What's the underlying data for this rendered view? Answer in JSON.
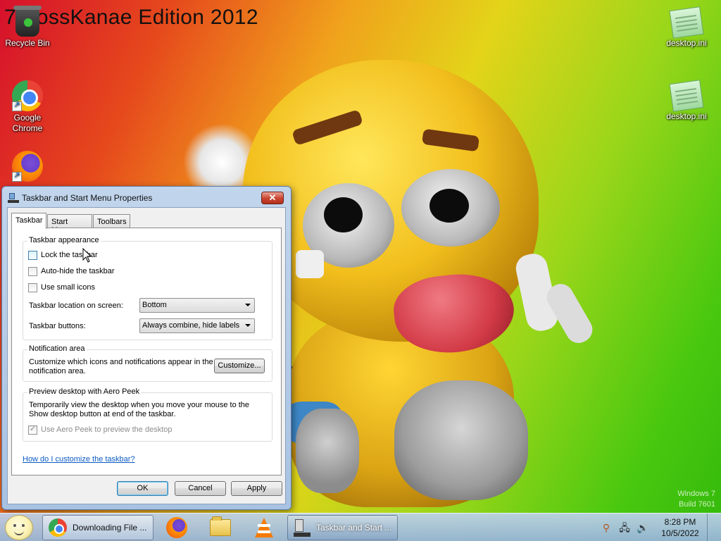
{
  "desktop": {
    "title": "7 BossKanae Edition 2012",
    "watermark_line1": "Windows 7",
    "watermark_line2": "Build 7601",
    "icons": [
      {
        "label": "Recycle Bin"
      },
      {
        "label": "Google Chrome"
      },
      {
        "label": "desktop.ini"
      },
      {
        "label": "desktop.ini"
      }
    ]
  },
  "dialog": {
    "title": "Taskbar and Start Menu Properties",
    "close_glyph": "✕",
    "tabs": [
      "Taskbar",
      "Start Menu",
      "Toolbars"
    ],
    "active_tab": "Taskbar",
    "appearance": {
      "heading": "Taskbar appearance",
      "lock_label": "Lock the taskbar",
      "lock_checked": false,
      "autohide_label": "Auto-hide the taskbar",
      "autohide_checked": false,
      "small_icons_label": "Use small icons",
      "small_icons_checked": false,
      "location_label": "Taskbar location on screen:",
      "location_value": "Bottom",
      "buttons_label": "Taskbar buttons:",
      "buttons_value": "Always combine, hide labels"
    },
    "notification": {
      "heading": "Notification area",
      "description": "Customize which icons and notifications appear in the notification area.",
      "customize_label": "Customize..."
    },
    "aero_peek": {
      "heading": "Preview desktop with Aero Peek",
      "description": "Temporarily view the desktop when you move your mouse to the Show desktop button at end of the taskbar.",
      "checkbox_label": "Use Aero Peek to preview the desktop",
      "checked": true,
      "enabled": false
    },
    "help_link": "How do I customize the taskbar?",
    "ok_label": "OK",
    "cancel_label": "Cancel",
    "apply_label": "Apply"
  },
  "taskbar": {
    "buttons": [
      {
        "label": "Downloading File ...",
        "icon": "chrome-icon"
      },
      {
        "label": "Taskbar and Start ...",
        "icon": "taskbar-properties-icon"
      }
    ],
    "pinned": [
      "firefox-icon",
      "folder-icon",
      "vlc-icon"
    ],
    "clock_time": "8:28 PM",
    "clock_date": "10/5/2022"
  }
}
